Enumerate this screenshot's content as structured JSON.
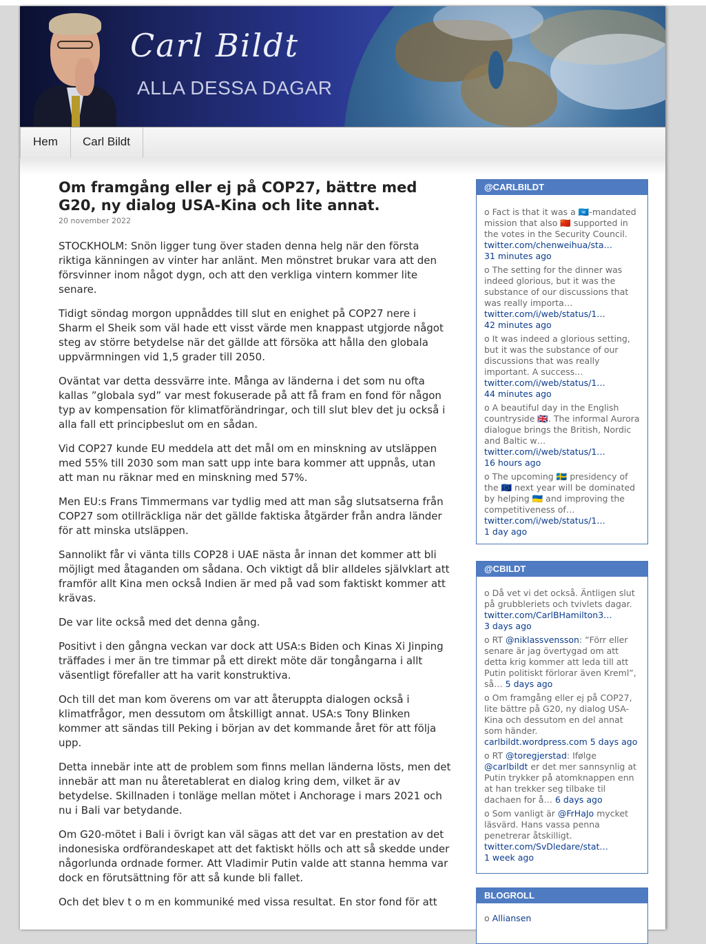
{
  "header": {
    "signature": "Carl Bildt",
    "tagline": "ALLA DESSA DAGAR"
  },
  "nav": {
    "items": [
      {
        "label": "Hem"
      },
      {
        "label": "Carl Bildt"
      }
    ]
  },
  "post": {
    "title": "Om framgång eller ej på COP27, bättre med G20, ny dialog USA-Kina och lite annat.",
    "date": "20 november 2022",
    "paragraphs": [
      "STOCKHOLM: Snön ligger tung över staden denna helg när den första riktiga känningen av vinter har anlänt. Men mönstret brukar vara att den försvinner inom något dygn, och att den verkliga vintern kommer lite senare.",
      "Tidigt söndag morgon uppnåddes till slut en enighet på COP27 nere i Sharm el Sheik som väl hade ett visst värde men knappast utgjorde något steg av större betydelse när det gällde att försöka att hålla den globala uppvärmningen vid 1,5 grader till 2050.",
      "Oväntat var detta dessvärre inte. Många av länderna i det som nu ofta kallas ”globala syd” var mest fokuserade på att få fram en fond för någon typ av kompensation för klimatförändringar, och till slut blev det ju också i alla fall ett principbeslut om en sådan.",
      "Vid COP27 kunde EU meddela att det mål om en minskning av utsläppen med 55% till 2030 som man satt upp inte bara kommer att uppnås, utan att man nu räknar med en minskning med 57%.",
      "Men EU:s Frans Timmermans var tydlig med att man såg slutsatserna från COP27 som otillräckliga när det gällde faktiska åtgärder från andra länder för att minska utsläppen.",
      "Sannolikt får vi vänta tills COP28 i UAE nästa år innan det kommer att bli möjligt med åtaganden om sådana. Och viktigt då blir alldeles självklart att framför allt Kina men också Indien är med på vad som faktiskt kommer att krävas.",
      "De var lite också med det denna gång.",
      "Positivt i den gångna veckan var dock att USA:s Biden och Kinas Xi Jinping träffades i mer än tre timmar på ett direkt möte där tongångarna i allt väsentligt förefaller att ha varit konstruktiva.",
      "Och till det man kom överens om var att återuppta dialogen också i klimatfrågor, men dessutom om åtskilligt annat. USA:s Tony Blinken kommer att sändas till Peking i början av det kommande året för att följa upp.",
      "Detta innebär inte att de problem som finns mellan länderna lösts, men det innebär att man nu återetablerat en dialog kring dem, vilket är av betydelse. Skillnaden i tonläge mellan mötet i Anchorage i mars 2021 och nu i Bali var betydande.",
      "Om G20-mötet i Bali i övrigt kan väl sägas att det var en prestation av det indonesiska ordförandeskapet att det faktiskt hölls och att så skedde under någorlunda ordnade former. Att Vladimir Putin valde att stanna hemma var dock en förutsättning för att så kunde bli fallet.",
      "Och det blev t o m en kommuniké med vissa resultat. En stor fond för att"
    ]
  },
  "sidebar": {
    "widget1": {
      "title": "@CARLBILDT",
      "items": [
        {
          "text": "Fact is that it was a 🇺🇳-mandated mission that also 🇨🇳 supported in the votes in the Security Council.",
          "link": "twitter.com/chenweihua/sta…",
          "time": "31 minutes ago"
        },
        {
          "text": "The setting for the dinner was indeed glorious, but it was the substance of our discussions that was really importa…",
          "link": "twitter.com/i/web/status/1…",
          "time": "42 minutes ago"
        },
        {
          "text": "It was indeed a glorious setting, but it was the substance of our discussions that was really important. A success…",
          "link": "twitter.com/i/web/status/1…",
          "time": "44 minutes ago"
        },
        {
          "text": "A beautiful day in the English countryside 🇬🇧. The informal Aurora dialogue brings the British, Nordic and Baltic w…",
          "link": "twitter.com/i/web/status/1…",
          "time": "16 hours ago"
        },
        {
          "text": "The upcoming 🇸🇪 presidency of the 🇪🇺 next year will be dominated by helping 🇺🇦 and improving the competitiveness of…",
          "link": "twitter.com/i/web/status/1…",
          "time": "1 day ago"
        }
      ]
    },
    "widget2": {
      "title": "@CBILDT",
      "items": [
        {
          "pre": "Då vet vi det också. Äntligen slut på grubbleriets och tvivlets dagar.",
          "link": "twitter.com/CarlBHamilton3…",
          "time": "3 days ago"
        },
        {
          "pre": "RT",
          "mention": "@niklassvensson",
          "post": ": ”Förr eller senare är jag övertygad om att detta krig kommer att leda till att Putin politiskt förlorar även Kreml”, så…",
          "time": "5 days ago"
        },
        {
          "pre": "Om framgång eller ej på COP27, lite bättre på G20, ny dialog USA-Kina och dessutom en del annat som händer.",
          "link": "carlbildt.wordpress.com",
          "time": "5 days ago"
        },
        {
          "pre": "RT",
          "mention": "@toregjerstad",
          "post": ": Ifølge",
          "mention2": "@carlbildt",
          "post2": "er det mer sannsynlig at Putin trykker på atomknappen enn at han trekker seg tilbake til dachaen for å…",
          "time": "6 days ago"
        },
        {
          "pre": "Som vanligt är",
          "mention": "@FrHaJo",
          "post": "mycket läsvärd. Hans vassa penna penetrerar åtskilligt.",
          "link": "twitter.com/SvDledare/stat…",
          "time": "1 week ago"
        }
      ]
    },
    "widget3": {
      "title": "BLOGROLL",
      "items": [
        {
          "label": "Alliansen"
        }
      ]
    }
  }
}
